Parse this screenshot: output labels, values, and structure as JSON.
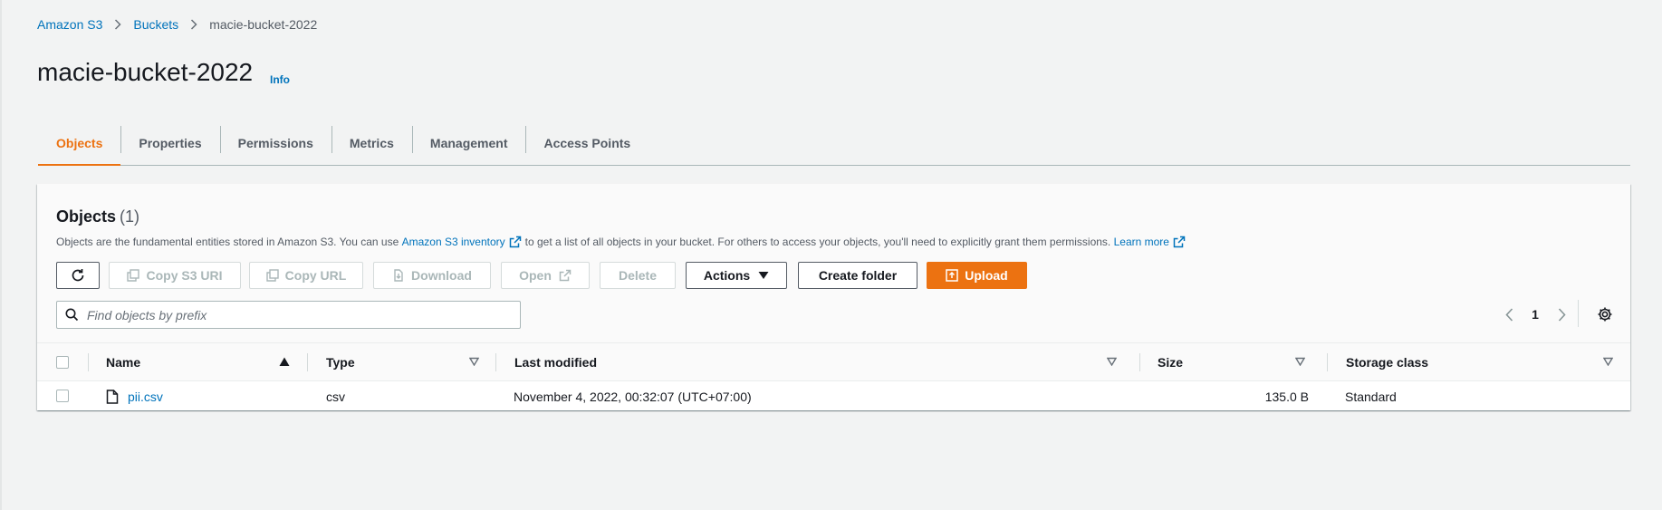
{
  "breadcrumb": {
    "items": [
      "Amazon S3",
      "Buckets"
    ],
    "current": "macie-bucket-2022"
  },
  "header": {
    "title": "macie-bucket-2022",
    "info": "Info"
  },
  "tabs": [
    "Objects",
    "Properties",
    "Permissions",
    "Metrics",
    "Management",
    "Access Points"
  ],
  "objects_panel": {
    "title": "Objects",
    "count": "(1)",
    "description": {
      "part1": "Objects are the fundamental entities stored in Amazon S3. You can use",
      "link1": "Amazon S3 inventory",
      "part2": "to get a list of all objects in your bucket. For others to access your objects, you'll need to explicitly grant them permissions.",
      "link2": "Learn more"
    },
    "toolbar": {
      "refresh_icon": "refresh-icon",
      "copy_s3_uri": "Copy S3 URI",
      "copy_url": "Copy URL",
      "download": "Download",
      "open": "Open",
      "delete": "Delete",
      "actions": "Actions",
      "create_folder": "Create folder",
      "upload": "Upload"
    },
    "search": {
      "placeholder": "Find objects by prefix",
      "value": ""
    },
    "pagination": {
      "page": "1"
    },
    "table": {
      "columns": [
        "Name",
        "Type",
        "Last modified",
        "Size",
        "Storage class"
      ],
      "rows": [
        {
          "name": "pii.csv",
          "type": "csv",
          "last_modified": "November 4, 2022, 00:32:07 (UTC+07:00)",
          "size": "135.0 B",
          "storage_class": "Standard"
        }
      ]
    }
  },
  "colors": {
    "accent": "#ec7211",
    "link": "#0073bb",
    "background": "#f2f3f3"
  }
}
